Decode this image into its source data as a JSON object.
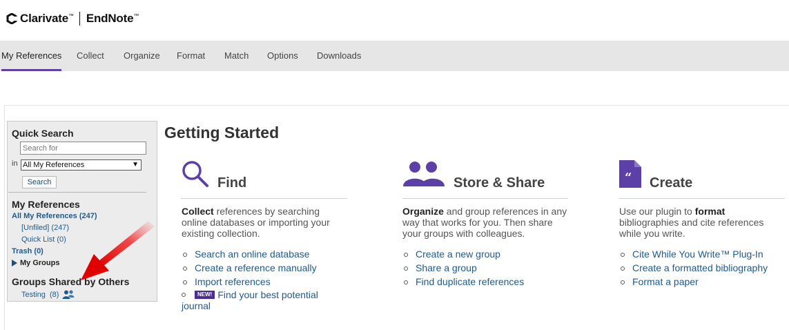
{
  "brand": {
    "company": "Clarivate",
    "product": "EndNote",
    "tm": "™",
    "accent_color": "#5d3fa8"
  },
  "nav": {
    "items": [
      {
        "label": "My References",
        "active": true
      },
      {
        "label": "Collect",
        "active": false
      },
      {
        "label": "Organize",
        "active": false
      },
      {
        "label": "Format",
        "active": false
      },
      {
        "label": "Match",
        "active": false
      },
      {
        "label": "Options",
        "active": false
      },
      {
        "label": "Downloads",
        "active": false
      }
    ]
  },
  "sidebar": {
    "quick_search": {
      "heading": "Quick Search",
      "placeholder": "Search for",
      "in_label": "in",
      "scope_value": "All My References",
      "button_label": "Search"
    },
    "my_references": {
      "heading": "My References",
      "all_refs": "All My References (247)",
      "unfiled": "[Unfiled] (247)",
      "quick_list": "Quick List (0)",
      "trash": "Trash (0)",
      "my_groups": "My Groups"
    },
    "shared": {
      "heading": "Groups Shared by Others",
      "group_name": "Testing",
      "group_count": "(8)",
      "group_icon": "shared-group-icon"
    }
  },
  "main": {
    "title": "Getting Started",
    "find": {
      "heading": "Find",
      "icon": "magnifier-icon",
      "desc_bold": "Collect",
      "desc_rest": " references by searching online databases or importing your existing collection.",
      "links": [
        "Search an online database",
        "Create a reference manually",
        "Import references"
      ],
      "new_badge": "NEW!",
      "new_link": "Find your best potential journal"
    },
    "store": {
      "heading": "Store & Share",
      "icon": "people-icon",
      "desc_bold": "Organize",
      "desc_rest": " and group references in any way that works for you. Then share your groups with colleagues.",
      "links": [
        "Create a new group",
        "Share a group",
        "Find duplicate references"
      ]
    },
    "create": {
      "heading": "Create",
      "icon": "document-quote-icon",
      "desc_pre": "Use our plugin to ",
      "desc_bold": "format",
      "desc_rest": " bibliographies and cite references while you write.",
      "links": [
        "Cite While You Write™ Plug-In",
        "Create a formatted bibliography",
        "Format a paper"
      ]
    }
  }
}
